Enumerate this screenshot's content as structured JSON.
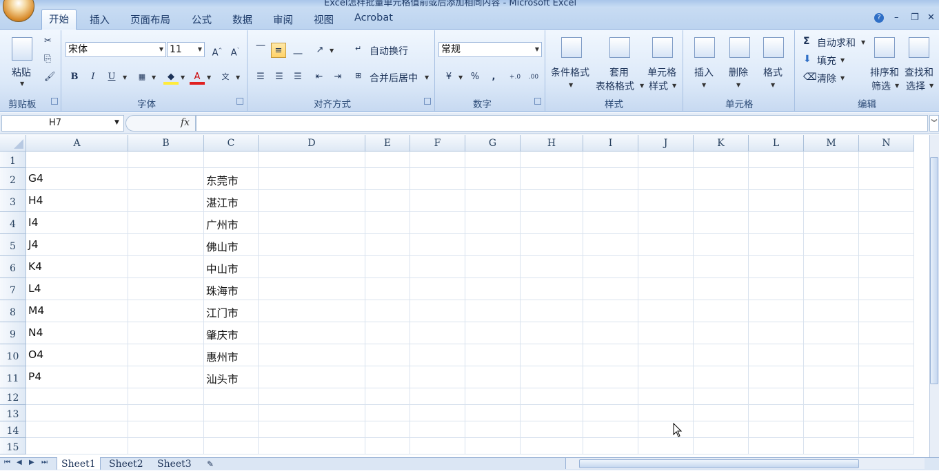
{
  "window": {
    "title": "Excel怎样批量单元格值前或后添加相同内容 - Microsoft Excel"
  },
  "tabs": [
    {
      "label": "开始",
      "active": true
    },
    {
      "label": "插入"
    },
    {
      "label": "页面布局"
    },
    {
      "label": "公式"
    },
    {
      "label": "数据"
    },
    {
      "label": "审阅"
    },
    {
      "label": "视图"
    },
    {
      "label": "Acrobat"
    }
  ],
  "ribbon": {
    "clipboard": {
      "label": "剪贴板",
      "paste": "粘贴"
    },
    "font": {
      "label": "字体",
      "name": "宋体",
      "size": "11",
      "bold": "B",
      "italic": "I",
      "underline": "U"
    },
    "alignment": {
      "label": "对齐方式",
      "wrap": "自动换行",
      "merge": "合并后居中"
    },
    "number": {
      "label": "数字",
      "format": "常规",
      "percent": "%",
      "comma": ","
    },
    "styles": {
      "label": "样式",
      "conditional": "条件格式",
      "table_line1": "套用",
      "table_line2": "表格格式",
      "cell_line1": "单元格",
      "cell_line2": "样式"
    },
    "cells": {
      "label": "单元格",
      "insert": "插入",
      "delete": "删除",
      "format": "格式"
    },
    "editing": {
      "label": "编辑",
      "autosum": "自动求和",
      "fill": "填充",
      "clear": "清除",
      "sort_line1": "排序和",
      "sort_line2": "筛选",
      "find_line1": "查找和",
      "find_line2": "选择"
    }
  },
  "formula_bar": {
    "name_box": "H7",
    "fx": "fx",
    "formula": ""
  },
  "columns": [
    "A",
    "B",
    "C",
    "D",
    "E",
    "F",
    "G",
    "H",
    "I",
    "J",
    "K",
    "L",
    "M",
    "N"
  ],
  "rows": [
    {
      "num": "1",
      "A": "",
      "C": ""
    },
    {
      "num": "2",
      "A": "G4",
      "C": "东莞市"
    },
    {
      "num": "3",
      "A": "H4",
      "C": "湛江市"
    },
    {
      "num": "4",
      "A": "I4",
      "C": "广州市"
    },
    {
      "num": "5",
      "A": "J4",
      "C": "佛山市"
    },
    {
      "num": "6",
      "A": "K4",
      "C": "中山市"
    },
    {
      "num": "7",
      "A": "L4",
      "C": "珠海市"
    },
    {
      "num": "8",
      "A": "M4",
      "C": "江门市"
    },
    {
      "num": "9",
      "A": "N4",
      "C": "肇庆市"
    },
    {
      "num": "10",
      "A": "O4",
      "C": "惠州市"
    },
    {
      "num": "11",
      "A": "P4",
      "C": "汕头市"
    },
    {
      "num": "12",
      "A": "",
      "C": ""
    },
    {
      "num": "13",
      "A": "",
      "C": ""
    },
    {
      "num": "14",
      "A": "",
      "C": ""
    },
    {
      "num": "15",
      "A": "",
      "C": ""
    }
  ],
  "sheets": [
    "Sheet1",
    "Sheet2",
    "Sheet3"
  ],
  "colors": {
    "accent": "#c7d9f1",
    "grid_line": "#d8e2ee",
    "header": "#dfe9f5"
  }
}
